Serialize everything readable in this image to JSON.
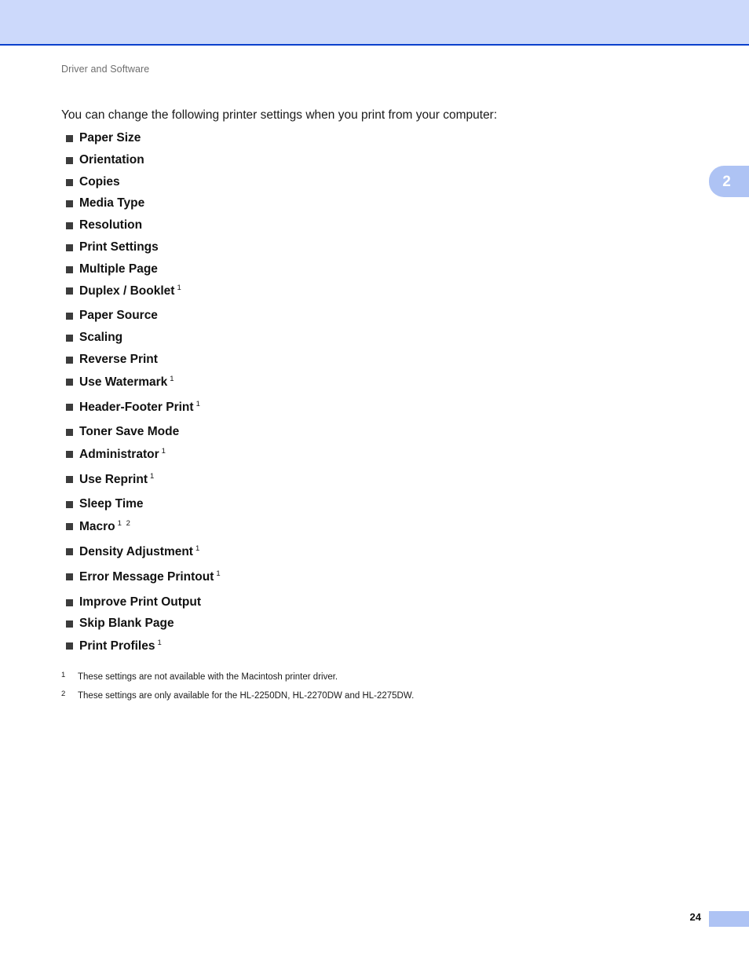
{
  "header": {
    "band_color": "#ccd9fb",
    "rule_color": "#0b41cd",
    "running_head": "Driver and Software"
  },
  "chapter_tab": {
    "number": "2",
    "color": "#aec3f4",
    "text_color": "#ffffff"
  },
  "main": {
    "intro": "You can change the following printer settings when you print from your computer:",
    "bullet_glyph": "square-bullet",
    "bullet_color": "#3c3c3c",
    "settings": [
      {
        "label": "Paper Size",
        "sup": ""
      },
      {
        "label": "Orientation",
        "sup": ""
      },
      {
        "label": "Copies",
        "sup": ""
      },
      {
        "label": "Media Type",
        "sup": ""
      },
      {
        "label": "Resolution",
        "sup": ""
      },
      {
        "label": "Print Settings",
        "sup": ""
      },
      {
        "label": "Multiple Page",
        "sup": ""
      },
      {
        "label": "Duplex / Booklet",
        "sup": "1"
      },
      {
        "label": "Paper Source",
        "sup": ""
      },
      {
        "label": "Scaling",
        "sup": ""
      },
      {
        "label": "Reverse Print",
        "sup": ""
      },
      {
        "label": "Use Watermark",
        "sup": "1"
      },
      {
        "label": "Header-Footer Print",
        "sup": "1"
      },
      {
        "label": "Toner Save Mode",
        "sup": ""
      },
      {
        "label": "Administrator",
        "sup": "1"
      },
      {
        "label": "Use Reprint",
        "sup": "1"
      },
      {
        "label": "Sleep Time",
        "sup": ""
      },
      {
        "label": "Macro",
        "sup": "1 2"
      },
      {
        "label": "Density Adjustment",
        "sup": "1"
      },
      {
        "label": "Error Message Printout",
        "sup": "1"
      },
      {
        "label": "Improve Print Output",
        "sup": ""
      },
      {
        "label": "Skip Blank Page",
        "sup": ""
      },
      {
        "label": "Print Profiles",
        "sup": "1"
      }
    ]
  },
  "footnotes": [
    {
      "marker": "1",
      "text": "These settings are not available with the Macintosh printer driver."
    },
    {
      "marker": "2",
      "text": "These settings are only available for the HL-2250DN, HL-2270DW and HL-2275DW."
    }
  ],
  "footer": {
    "page_number": "24",
    "swatch_color": "#aec3f4"
  }
}
